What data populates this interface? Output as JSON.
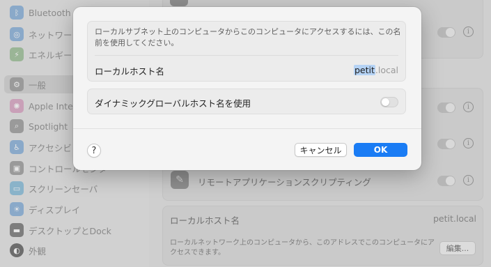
{
  "sidebar": {
    "items": [
      {
        "label": "Bluetooth",
        "icon": "bluetooth-icon",
        "color": "#8aa9c9"
      },
      {
        "label": "ネットワーク",
        "icon": "globe-icon",
        "color": "#8aa9c9"
      },
      {
        "label": "エネルギー",
        "icon": "battery-icon",
        "color": "#9ab596"
      },
      {
        "label": "一般",
        "icon": "gear-icon",
        "color": "#9a9a9a",
        "selected": true
      },
      {
        "label": "Apple Intelligence",
        "icon": "apple-intelligence-icon",
        "color": "#c9a0b8"
      },
      {
        "label": "Spotlight",
        "icon": "spotlight-icon",
        "color": "#9a9a9a"
      },
      {
        "label": "アクセシビリティ",
        "icon": "accessibility-icon",
        "color": "#8aa9c9"
      },
      {
        "label": "コントロールセンター",
        "icon": "control-center-icon",
        "color": "#9a9a9a"
      },
      {
        "label": "スクリーンセーバ",
        "icon": "screensaver-icon",
        "color": "#8ab3c9"
      },
      {
        "label": "ディスプレイ",
        "icon": "display-icon",
        "color": "#8aa9c9"
      },
      {
        "label": "デスクトップとDock",
        "icon": "dock-icon",
        "color": "#7d7d7d"
      },
      {
        "label": "外観",
        "icon": "appearance-icon",
        "color": "#6d6d6d"
      }
    ]
  },
  "background": {
    "remote_scripting_label": "リモートアプリケーションスクリプティング",
    "local_hostname_label": "ローカルホスト名",
    "local_hostname_value": "petit.local",
    "local_hostname_desc": "ローカルネットワーク上のコンピュータから、このアドレスでこのコンピュータにアクセスできます。",
    "edit_button": "編集..."
  },
  "sheet": {
    "description": "ローカルサブネット上のコンピュータからこのコンピュータにアクセスするには、この名前を使用してください。",
    "hostname_label": "ローカルホスト名",
    "hostname_selected": "petit",
    "hostname_suffix": ".local",
    "dynamic_label": "ダイナミックグローバルホスト名を使用",
    "dynamic_enabled": false,
    "help_label": "?",
    "cancel_label": "キャンセル",
    "ok_label": "OK",
    "accent_color": "#1a7cf4"
  }
}
